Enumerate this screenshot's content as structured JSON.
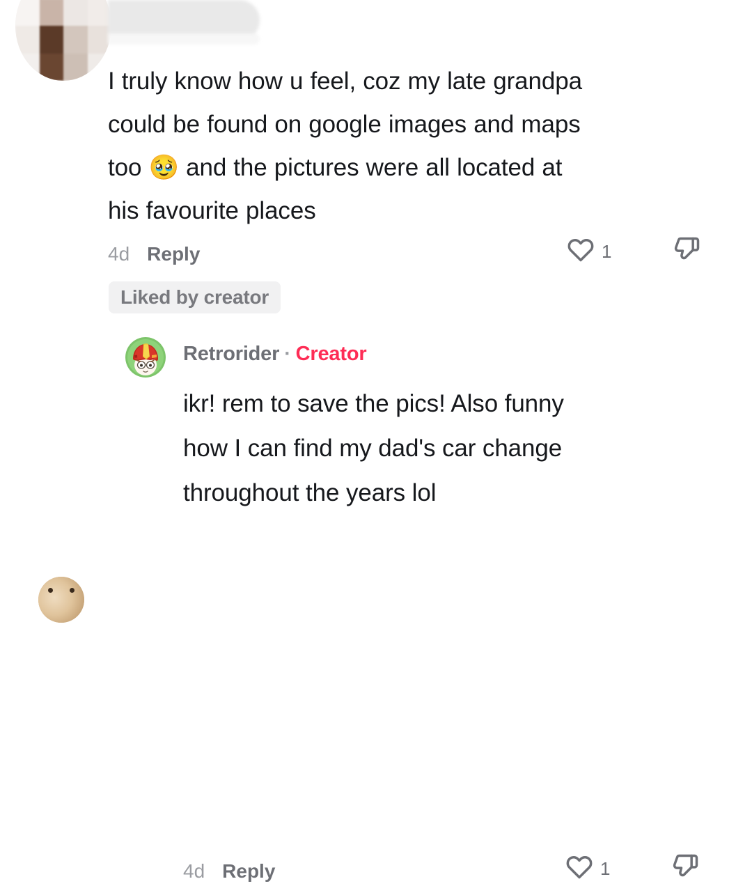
{
  "app": "tiktok-comments",
  "colors": {
    "text": "#16181c",
    "muted": "#9a9ca1",
    "secondary": "#6d6f75",
    "creator_accent": "#fe2c55",
    "badge_bg": "#f1f1f2",
    "background": "#ffffff"
  },
  "comment": {
    "avatar": "censored-pixelated-avatar",
    "username": "",
    "username_state": "censored",
    "text_lines": [
      "I truly know how u feel, coz my late grandpa",
      "could be found on google images and maps",
      "too 🥹 and the pictures were all located at",
      "his favourite places"
    ],
    "text": "I truly know how u feel, coz my late grandpa could be found on google images and maps too 🥹 and the pictures were all located at his favourite places",
    "emoji": "🥹",
    "emoji_name": "face-holding-back-tears",
    "timestamp": "4d",
    "reply_label": "Reply",
    "like_count": "1",
    "like_icon": "heart-outline-icon",
    "dislike_icon": "thumbs-down-outline-icon",
    "liked_by_creator_label": "Liked by creator"
  },
  "reply": {
    "avatar": "retrorider-helmet-avatar",
    "username": "Retrorider",
    "separator": "·",
    "creator_badge": "Creator",
    "text_lines": [
      "ikr! rem to save the pics! Also funny",
      "how I can find my dad's car change",
      "throughout the years lol"
    ],
    "text": "ikr! rem to save the pics! Also funny how I can find my dad's car change throughout the years lol",
    "timestamp": "4d",
    "reply_label": "Reply",
    "like_count": "1",
    "like_icon": "heart-outline-icon",
    "dislike_icon": "thumbs-down-outline-icon"
  },
  "next_comment": {
    "avatar": "partially-visible-avatar"
  }
}
